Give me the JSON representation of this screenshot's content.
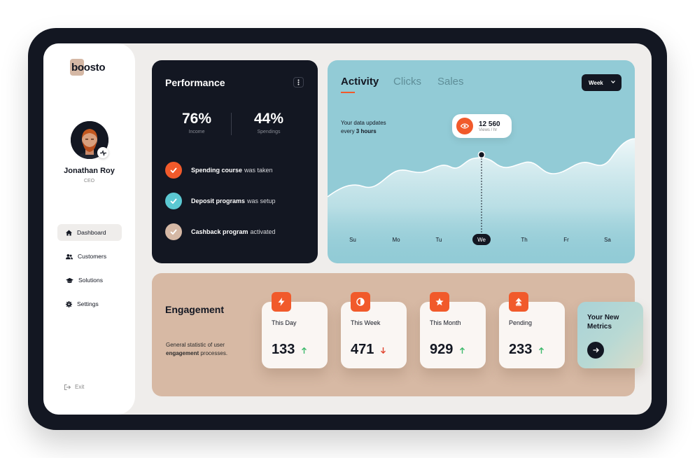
{
  "app": {
    "logo": "boosto"
  },
  "user": {
    "name": "Jonathan Roy",
    "role": "CEO"
  },
  "sidebar": {
    "items": [
      {
        "label": "Dashboard",
        "icon": "home-icon",
        "active": true
      },
      {
        "label": "Customers",
        "icon": "users-icon",
        "active": false
      },
      {
        "label": "Solutions",
        "icon": "graduation-cap-icon",
        "active": false
      },
      {
        "label": "Settings",
        "icon": "gear-icon",
        "active": false
      }
    ],
    "exit_label": "Exit"
  },
  "performance": {
    "title": "Performance",
    "stats": [
      {
        "value": "76%",
        "label": "Income"
      },
      {
        "value": "44%",
        "label": "Spendings"
      }
    ],
    "tasks": [
      {
        "bold": "Spending course",
        "rest": "was taken",
        "color": "#f15a2b"
      },
      {
        "bold": "Deposit programs",
        "rest": "was setup",
        "color": "#5bc8d2"
      },
      {
        "bold": "Cashback program",
        "rest": "activated",
        "color": "#d5b8a5"
      }
    ]
  },
  "activity": {
    "tabs": [
      "Activity",
      "Clicks",
      "Sales"
    ],
    "active_tab": "Activity",
    "period": "Week",
    "update_line1": "Your data updates",
    "update_prefix": "every",
    "update_bold": "3 hours",
    "tooltip_value": "12 560",
    "tooltip_label": "Views / hr",
    "days": [
      "Su",
      "Mo",
      "Tu",
      "We",
      "Th",
      "Fr",
      "Sa"
    ],
    "active_day": "We",
    "accent": "#f15a2b"
  },
  "engagement": {
    "title": "Engagement",
    "desc_pre": "General statistic of user",
    "desc_bold": "engagement",
    "desc_post": "processes.",
    "cards": [
      {
        "label": "This Day",
        "value": "133",
        "trend": "up",
        "icon": "lightning-icon"
      },
      {
        "label": "This Week",
        "value": "471",
        "trend": "down",
        "icon": "half-circle-icon"
      },
      {
        "label": "This Month",
        "value": "929",
        "trend": "up",
        "icon": "star-icon"
      },
      {
        "label": "Pending",
        "value": "233",
        "trend": "up",
        "icon": "double-chevron-up-icon"
      }
    ],
    "metrics_title": "Your New Metrics"
  }
}
